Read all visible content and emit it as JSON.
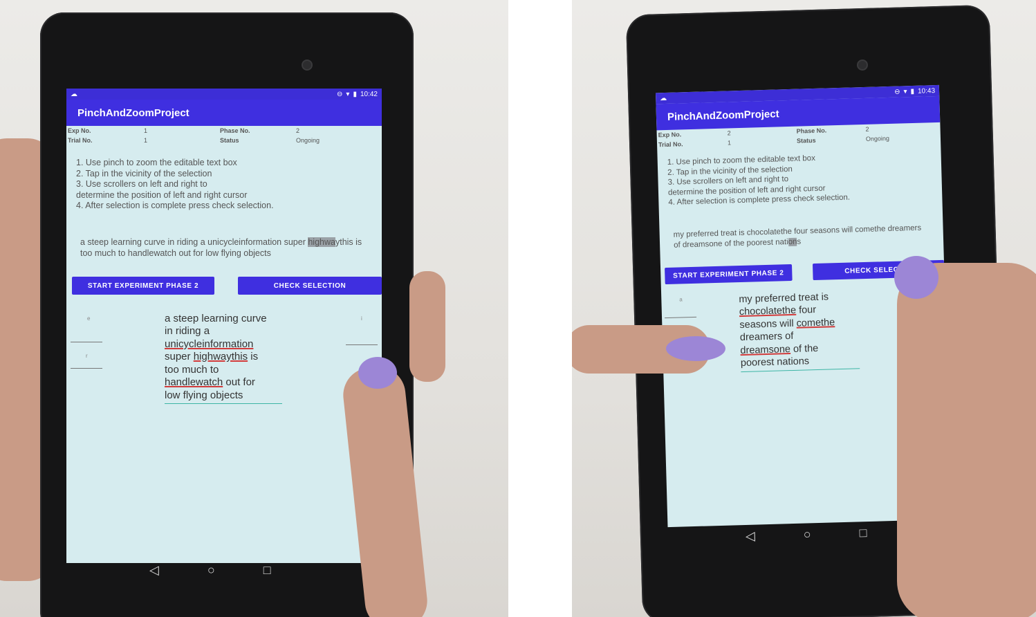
{
  "status_bar": {
    "left": {
      "time": "10:42"
    },
    "right": {
      "time": "10:43"
    }
  },
  "app": {
    "title": "PinchAndZoomProject"
  },
  "info": {
    "left": {
      "exp_label": "Exp No.",
      "exp_value": "1",
      "phase_label": "Phase No.",
      "phase_value": "2",
      "trial_label": "Trial No.",
      "trial_value": "1",
      "status_label": "Status",
      "status_value": "Ongoing"
    },
    "right": {
      "exp_label": "Exp No.",
      "exp_value": "2",
      "phase_label": "Phase No.",
      "phase_value": "2",
      "trial_label": "Trial No.",
      "trial_value": "1",
      "status_label": "Status",
      "status_value": "Ongoing"
    }
  },
  "instructions": {
    "line1": "1. Use pinch to zoom the editable text box",
    "line2": "2. Tap in the vicinity of the selection",
    "line3": "3. Use scrollers on left and right to",
    "line4": "determine the position of left and right cursor",
    "line5": "4. After selection is complete press check selection."
  },
  "left": {
    "sentence_pre": "a steep learning curve in riding a unicycleinformation super",
    "sentence_hl": "highwa",
    "sentence_post": "ythis is too much to handlewatch out for low flying objects",
    "zoom_lines": {
      "l1": "a steep learning curve",
      "l2": "in riding a",
      "l3": "unicycleinformation",
      "l4a": "super ",
      "l4b": "highwaythis",
      "l4c": " is",
      "l5": "too much to",
      "l6a": "handlewatch",
      "l6b": " out for",
      "l7": "low flying objects"
    },
    "scroller_glyphs": {
      "e": "e",
      "r": "r",
      "i": "i"
    }
  },
  "right": {
    "sentence_pre": "my preferred treat is chocolatethe four seasons will comethe dreamers of dreamsone of the poorest nati",
    "sentence_hl": "on",
    "sentence_post": "s",
    "zoom_lines": {
      "l1": "my preferred treat is",
      "l2a": "chocolatethe",
      "l2b": " four",
      "l3a": "seasons will ",
      "l3b": "comethe",
      "l4": "dreamers of",
      "l5a": "dreamsone",
      "l5b": " of the",
      "l6": "poorest nations"
    },
    "scroller_glyphs": {
      "a": "a",
      "m": "m"
    }
  },
  "buttons": {
    "start": "START EXPERIMENT PHASE 2",
    "check": "CHECK SELECTION",
    "check_truncated": "CHECK SELEC"
  },
  "nav": {
    "back": "◁",
    "home": "○",
    "recents": "□"
  },
  "colors": {
    "appbar": "#3f2fe0",
    "screen_bg": "#d6ecef",
    "spell_error": "#d23a3a",
    "edit_underline": "#3cb5a5"
  }
}
